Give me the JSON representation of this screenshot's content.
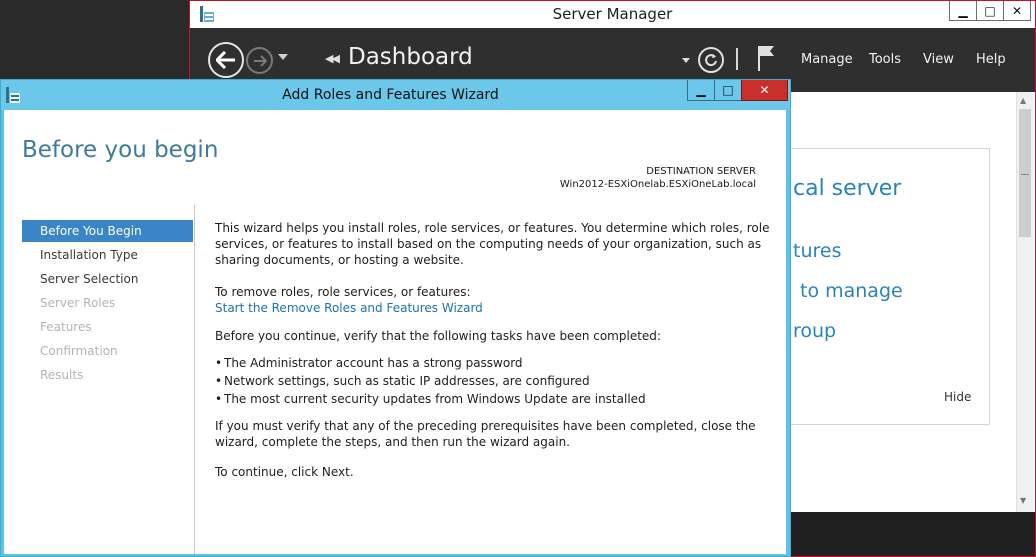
{
  "server_manager": {
    "title": "Server Manager",
    "controls": {
      "minimize": "▁",
      "maximize": "□",
      "close": "✕"
    },
    "breadcrumb": "Dashboard",
    "menu": [
      "Manage",
      "Tools",
      "View",
      "Help"
    ],
    "tile": {
      "title_fragment": "cal server",
      "line1": "tures",
      "line2": "to manage",
      "line3": "roup",
      "hide_label": "Hide"
    }
  },
  "wizard": {
    "title": "Add Roles and Features Wizard",
    "controls": {
      "minimize": "▁",
      "maximize": "□",
      "close": "✕"
    },
    "heading": "Before you begin",
    "destination_label": "DESTINATION SERVER",
    "destination_value": "Win2012-ESXiOnelab.ESXiOneLab.local",
    "steps": [
      {
        "label": "Before You Begin",
        "state": "active"
      },
      {
        "label": "Installation Type",
        "state": "done"
      },
      {
        "label": "Server Selection",
        "state": "done"
      },
      {
        "label": "Server Roles",
        "state": "disabled"
      },
      {
        "label": "Features",
        "state": "disabled"
      },
      {
        "label": "Confirmation",
        "state": "disabled"
      },
      {
        "label": "Results",
        "state": "disabled"
      }
    ],
    "content": {
      "intro": "This wizard helps you install roles, role services, or features. You determine which roles, role services, or features to install based on the computing needs of your organization, such as sharing documents, or hosting a website.",
      "remove_label": "To remove roles, role services, or features:",
      "remove_link": "Start the Remove Roles and Features Wizard",
      "verify": "Before you continue, verify that the following tasks have been completed:",
      "bullets": [
        "The Administrator account has a strong password",
        "Network settings, such as static IP addresses, are configured",
        "The most current security updates from Windows Update are installed"
      ],
      "must_verify": "If you must verify that any of the preceding prerequisites have been completed, close the wizard, complete the steps, and then run the wizard again.",
      "continue": "To continue, click Next."
    }
  },
  "colors": {
    "wizard_frame": "#5bc3e6",
    "active_step": "#3a85c5",
    "heading": "#3d7b97",
    "link": "#1e73a8",
    "close_button": "#c9302c",
    "toolbar": "#2f2f2f"
  }
}
